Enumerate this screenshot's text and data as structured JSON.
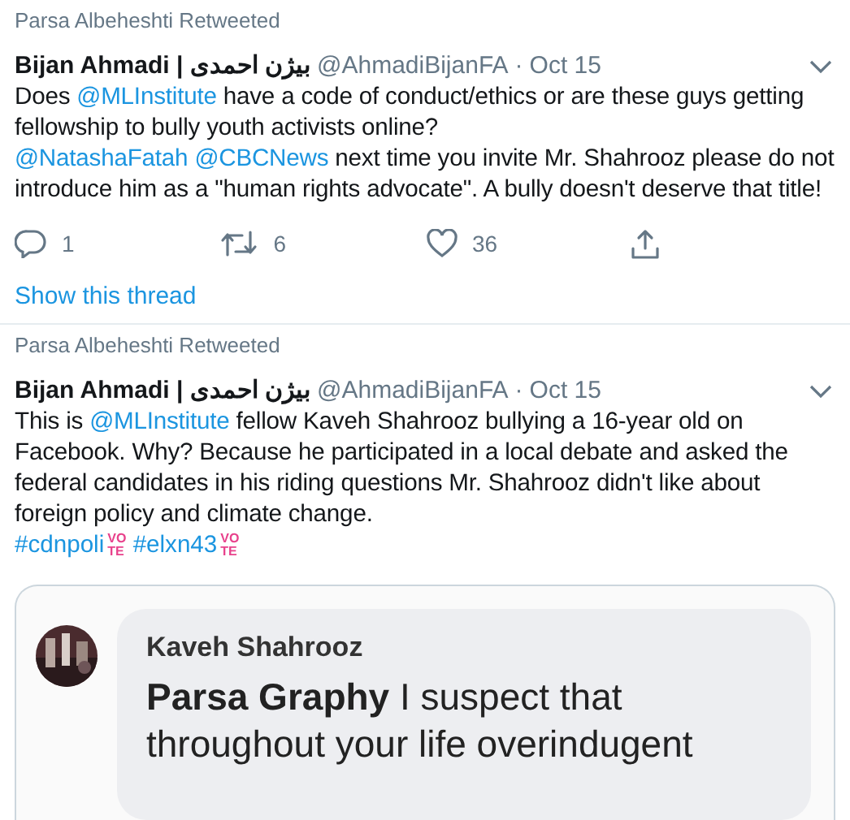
{
  "tweets": [
    {
      "retweeted_by": "Parsa Albeheshti Retweeted",
      "name": "Bijan Ahmadi | بیژن احمدی",
      "handle": "@AhmadiBijanFA",
      "separator": "·",
      "date": "Oct 15",
      "paragraphs": [
        [
          {
            "kind": "text",
            "text": "Does "
          },
          {
            "kind": "mention",
            "text": "@MLInstitute"
          },
          {
            "kind": "text",
            "text": " have a code of conduct/ethics or are these guys getting fellowship to bully youth activists online?"
          }
        ],
        [
          {
            "kind": "mention",
            "text": "@NatashaFatah"
          },
          {
            "kind": "mention",
            "text": "@CBCNews"
          },
          {
            "kind": "text",
            "text": " next time you invite Mr. Shahrooz please do not introduce him as a \"human rights advocate\". A bully doesn't deserve that title!"
          }
        ]
      ],
      "actions": [
        {
          "kind": "reply",
          "count": "1"
        },
        {
          "kind": "retweet",
          "count": "6"
        },
        {
          "kind": "like",
          "count": "36"
        },
        {
          "kind": "share"
        }
      ],
      "show_thread": "Show this thread"
    },
    {
      "retweeted_by": "Parsa Albeheshti Retweeted",
      "name": "Bijan Ahmadi | بیژن احمدی",
      "handle": "@AhmadiBijanFA",
      "separator": "·",
      "date": "Oct 15",
      "paragraphs": [
        [
          {
            "kind": "text",
            "text": "This is "
          },
          {
            "kind": "mention",
            "text": "@MLInstitute"
          },
          {
            "kind": "text",
            "text": " fellow Kaveh Shahrooz bullying a 16-year old on Facebook. Why? Because he participated in a local debate and asked the federal candidates in his riding questions Mr. Shahrooz didn't like about foreign policy and climate change."
          }
        ],
        [
          {
            "kind": "hashtag",
            "text": "#cdnpoli",
            "emoji": [
              "VO",
              "TE"
            ]
          },
          {
            "kind": "hashtag",
            "text": "#elxn43",
            "emoji": [
              "VO",
              "TE"
            ]
          }
        ]
      ],
      "media": {
        "commenter": "Kaveh Shahrooz",
        "comment": "**Parsa Graphy** I suspect that throughout your life overindugent"
      }
    }
  ]
}
